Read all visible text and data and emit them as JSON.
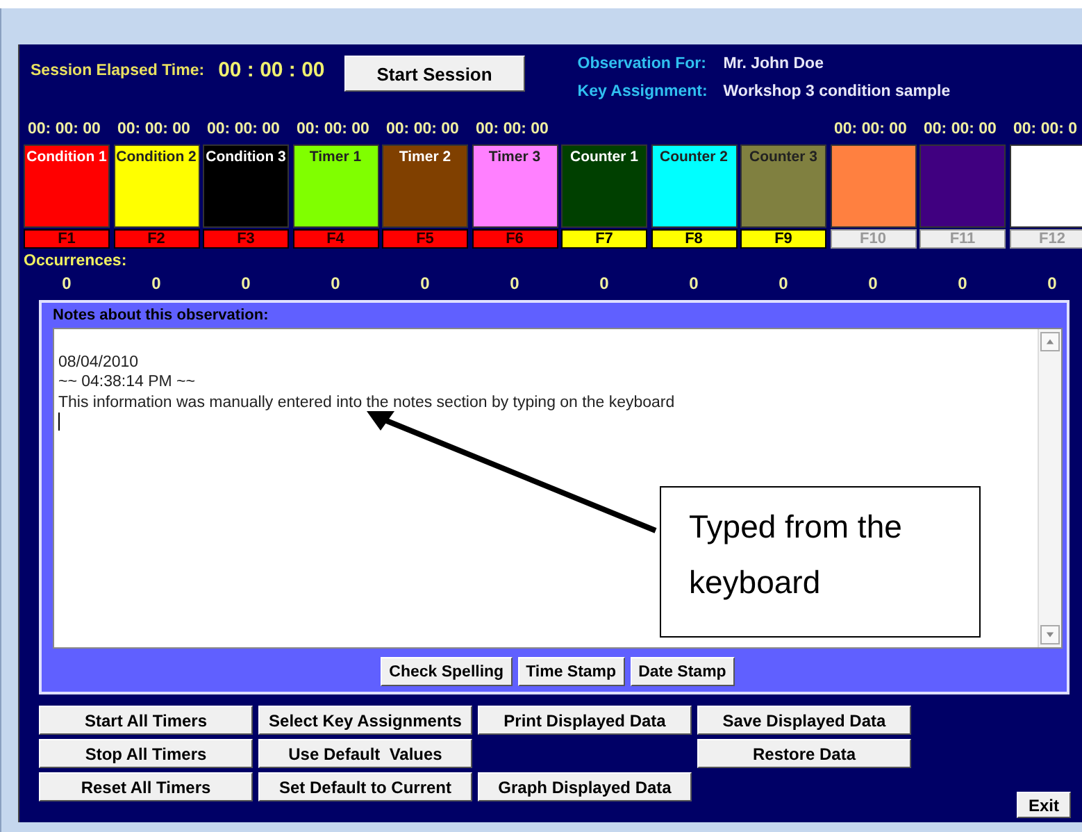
{
  "header": {
    "elapsed_label": "Session Elapsed Time:",
    "elapsed_time": "00 : 00 : 00",
    "start_button": "Start Session",
    "observation_label": "Observation For:",
    "observation_value": "Mr. John Doe",
    "assignment_label": "Key Assignment:",
    "assignment_value": "Workshop 3 condition sample"
  },
  "tiles": [
    {
      "kind": "condition",
      "label": "Condition 1",
      "color": "#ff0000",
      "time": "00: 00: 00",
      "key": "F1",
      "occurrences": "0"
    },
    {
      "kind": "condition",
      "label": "Condition 2",
      "color": "#ffff00",
      "time": "00: 00: 00",
      "key": "F2",
      "occurrences": "0"
    },
    {
      "kind": "condition",
      "label": "Condition 3",
      "color": "#000000",
      "time": "00: 00: 00",
      "key": "F3",
      "occurrences": "0"
    },
    {
      "kind": "timer",
      "label": "Timer 1",
      "color": "#80ff00",
      "time": "00: 00: 00",
      "key": "F4",
      "occurrences": "0"
    },
    {
      "kind": "timer",
      "label": "Timer 2",
      "color": "#804000",
      "time": "00: 00: 00",
      "key": "F5",
      "occurrences": "0"
    },
    {
      "kind": "timer",
      "label": "Timer 3",
      "color": "#ff80ff",
      "time": "00: 00: 00",
      "key": "F6",
      "occurrences": "0"
    },
    {
      "kind": "counter",
      "label": "Counter 1",
      "color": "#004000",
      "key": "F7",
      "occurrences": "0"
    },
    {
      "kind": "counter",
      "label": "Counter 2",
      "color": "#00ffff",
      "key": "F8",
      "occurrences": "0"
    },
    {
      "kind": "counter",
      "label": "Counter 3",
      "color": "#808040",
      "key": "F9",
      "occurrences": "0"
    },
    {
      "kind": "unassigned",
      "color": "#ff8040",
      "time": "00: 00: 00",
      "key": "F10",
      "occurrences": "0"
    },
    {
      "kind": "unassigned",
      "color": "#400080",
      "time": "00: 00: 00",
      "key": "F11",
      "occurrences": "0"
    },
    {
      "kind": "unassigned",
      "color": "#ffffff",
      "time": "00: 00: 0",
      "key": "F12",
      "occurrences": "0"
    }
  ],
  "occurrences_label": "Occurrences:",
  "notes": {
    "title": "Notes about this observation:",
    "value": "\n08/04/2010\n~~ 04:38:14 PM ~~\nThis information was manually entered into the notes section by typing on the keyboard\n",
    "buttons": [
      "Check Spelling",
      "Time Stamp",
      "Date Stamp"
    ]
  },
  "callout": {
    "text": "Typed from the keyboard"
  },
  "button_columns": [
    {
      "kind": "stack",
      "buttons": [
        "Start All Timers",
        "Stop All Timers",
        "Reset All Timers"
      ]
    },
    {
      "kind": "stack",
      "buttons": [
        "Select Key Assignments",
        "Use Default  Values",
        "Set Default to Current"
      ]
    },
    {
      "kind": "split",
      "buttons": [
        "Print Displayed Data",
        "Graph Displayed Data"
      ]
    },
    {
      "kind": "stack",
      "buttons": [
        "Save Displayed Data",
        "Restore Data"
      ]
    }
  ],
  "exit_button": "Exit"
}
